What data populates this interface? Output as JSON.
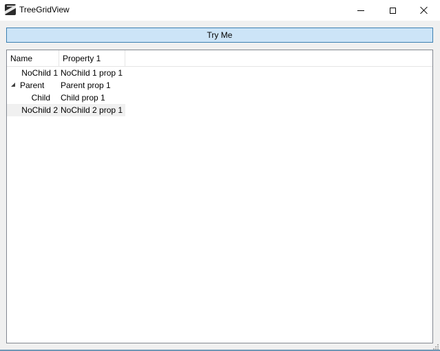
{
  "window": {
    "title": "TreeGridView",
    "icon": "app-icon"
  },
  "toolbar": {
    "try_label": "Try Me"
  },
  "grid": {
    "columns": [
      "Name",
      "Property 1"
    ],
    "rows": [
      {
        "name": "NoChild 1",
        "prop": "NoChild 1 prop 1",
        "level": 0,
        "expandable": false
      },
      {
        "name": "Parent",
        "prop": "Parent prop 1",
        "level": 0,
        "expandable": true,
        "expanded": true
      },
      {
        "name": "Child",
        "prop": "Child prop 1",
        "level": 1,
        "expandable": false
      },
      {
        "name": "NoChild 2",
        "prop": "NoChild 2 prop 1",
        "level": 0,
        "expandable": false,
        "selected": true
      }
    ]
  },
  "colors": {
    "button_bg": "#cce4f7",
    "button_border": "#3c7fb1",
    "selected_row": "#f0f0f0",
    "window_bg": "#f0f0f0"
  }
}
